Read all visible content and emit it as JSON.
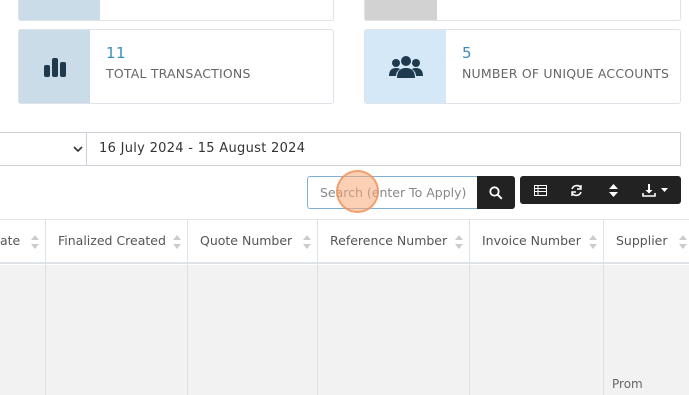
{
  "stats": {
    "transactions": {
      "value": "11",
      "label": "TOTAL TRANSACTIONS",
      "icon": "bar-chart-icon"
    },
    "unique_accounts": {
      "value": "5",
      "label": "NUMBER OF UNIQUE ACCOUNTS",
      "icon": "users-icon"
    }
  },
  "filters": {
    "date_range": "16 July 2024 - 15 August 2024"
  },
  "search": {
    "placeholder": "Search (enter To Apply)"
  },
  "toolbar": {
    "buttons": [
      "table-columns-icon",
      "refresh-icon",
      "sort-toggle-icon",
      "download-icon"
    ]
  },
  "table": {
    "columns": [
      "ate",
      "Finalized Created",
      "Quote Number",
      "Reference Number",
      "Invoice Number",
      "Supplier"
    ],
    "partial_cell": "Prom"
  },
  "colors": {
    "accent": "#3c8dbc",
    "toolbar": "#222222",
    "card_icon_bg_blue": "#c9dce8",
    "card_icon_bg_lightblue": "#d4e8f8"
  }
}
